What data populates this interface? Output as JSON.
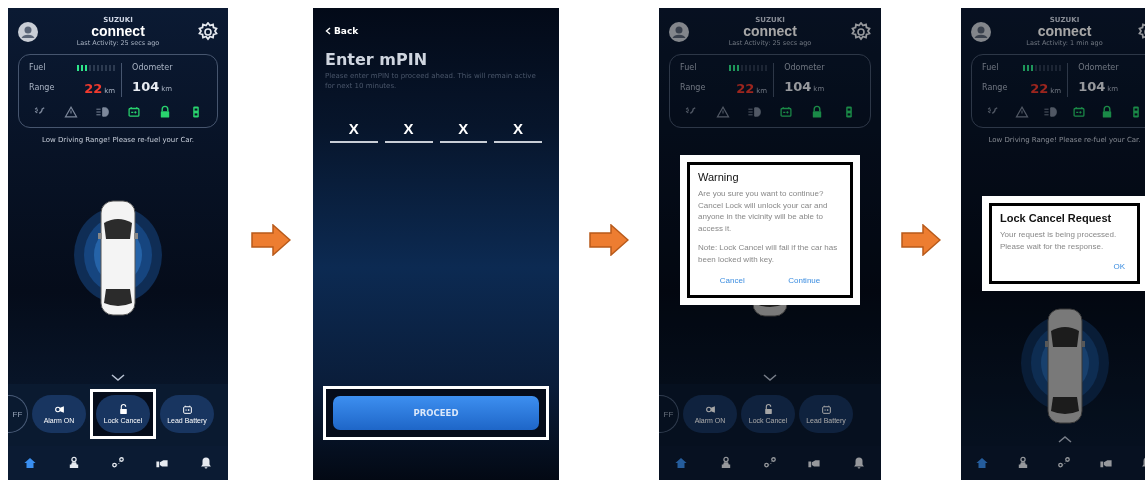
{
  "screens": [
    {
      "kind": "dashboard",
      "dimmed": false,
      "header": {
        "brand_small": "SUZUKI",
        "brand": "connect",
        "last_activity": "Last Activity: 25 secs ago"
      },
      "status_card": {
        "fuel_label": "Fuel",
        "fuel_gauge": {
          "level": 0.3
        },
        "range_label": "Range",
        "range_value": "22",
        "range_unit": "km",
        "odometer_label": "Odometer",
        "odometer_value": "104",
        "odometer_unit": "km",
        "indicators": [
          {
            "on": false
          },
          {
            "on": false
          },
          {
            "on": false
          },
          {
            "on": true
          },
          {
            "on": true
          },
          {
            "on": true
          }
        ]
      },
      "message": "Low Driving Range! Please re-fuel your Car.",
      "drawer": {
        "expanded": true,
        "actions": [
          {
            "kind": "round",
            "label": "FF",
            "highlighted": false
          },
          {
            "kind": "pill",
            "label": "Alarm ON",
            "highlighted": false
          },
          {
            "kind": "pill",
            "label": "Lock Cancel",
            "highlighted": true
          },
          {
            "kind": "pill",
            "label": "Lead Battery",
            "highlighted": false
          }
        ]
      },
      "nav": [
        {
          "selected": true
        },
        {
          "selected": false
        },
        {
          "selected": false
        },
        {
          "selected": false
        },
        {
          "selected": false
        }
      ]
    },
    {
      "kind": "mpin",
      "back": "Back",
      "title": "Enter mPIN",
      "description": "Please enter mPIN to proceed ahead. This will remain active for next 10 minutes.",
      "pin_digits": [
        "X",
        "X",
        "X",
        "X"
      ],
      "proceed": {
        "label": "PROCEED",
        "highlighted": true
      }
    },
    {
      "kind": "dashboard",
      "dimmed": true,
      "header": {
        "brand_small": "SUZUKI",
        "brand": "connect",
        "last_activity": "Last Activity: 25 secs ago"
      },
      "status_card": {
        "fuel_label": "Fuel",
        "fuel_gauge": {
          "level": 0.3
        },
        "range_label": "Range",
        "range_value": "22",
        "range_unit": "km",
        "odometer_label": "Odometer",
        "odometer_value": "104",
        "odometer_unit": "km",
        "indicators": [
          {
            "on": false
          },
          {
            "on": false
          },
          {
            "on": false
          },
          {
            "on": true
          },
          {
            "on": true
          },
          {
            "on": true
          }
        ]
      },
      "drawer": {
        "expanded": true,
        "actions": [
          {
            "kind": "round",
            "label": "FF",
            "highlighted": false
          },
          {
            "kind": "pill",
            "label": "Alarm ON",
            "highlighted": false
          },
          {
            "kind": "pill",
            "label": "Lock Cancel",
            "highlighted": false
          },
          {
            "kind": "pill",
            "label": "Lead Battery",
            "highlighted": false
          }
        ]
      },
      "nav": [
        {
          "selected": true
        },
        {
          "selected": false
        },
        {
          "selected": false
        },
        {
          "selected": false
        },
        {
          "selected": false
        }
      ],
      "dialog": {
        "title": "Warning",
        "paragraphs": [
          "Are you sure you want to continue? Cancel Lock will unlock your car and anyone in the vicinity will be able to access it.",
          "Note: Lock Cancel will fail if the car has been locked with key."
        ],
        "buttons": [
          "Cancel",
          "Continue"
        ]
      }
    },
    {
      "kind": "dashboard",
      "dimmed": true,
      "header": {
        "brand_small": "SUZUKI",
        "brand": "connect",
        "last_activity": "Last Activity: 1 min ago"
      },
      "status_card": {
        "fuel_label": "Fuel",
        "fuel_gauge": {
          "level": 0.3
        },
        "range_label": "Range",
        "range_value": "22",
        "range_unit": "km",
        "odometer_label": "Odometer",
        "odometer_value": "104",
        "odometer_unit": "km",
        "indicators": [
          {
            "on": false
          },
          {
            "on": false
          },
          {
            "on": false
          },
          {
            "on": true
          },
          {
            "on": true
          },
          {
            "on": true
          }
        ]
      },
      "message": "Low Driving Range! Please re-fuel your Car.",
      "drawer": {
        "expanded": false
      },
      "nav": [
        {
          "selected": true
        },
        {
          "selected": false
        },
        {
          "selected": false
        },
        {
          "selected": false
        },
        {
          "selected": false
        }
      ],
      "dialog": {
        "title": "Lock Cancel Request",
        "paragraphs": [
          "Your request is being processed. Please wait for the response."
        ],
        "buttons": [
          "OK"
        ]
      }
    }
  ]
}
